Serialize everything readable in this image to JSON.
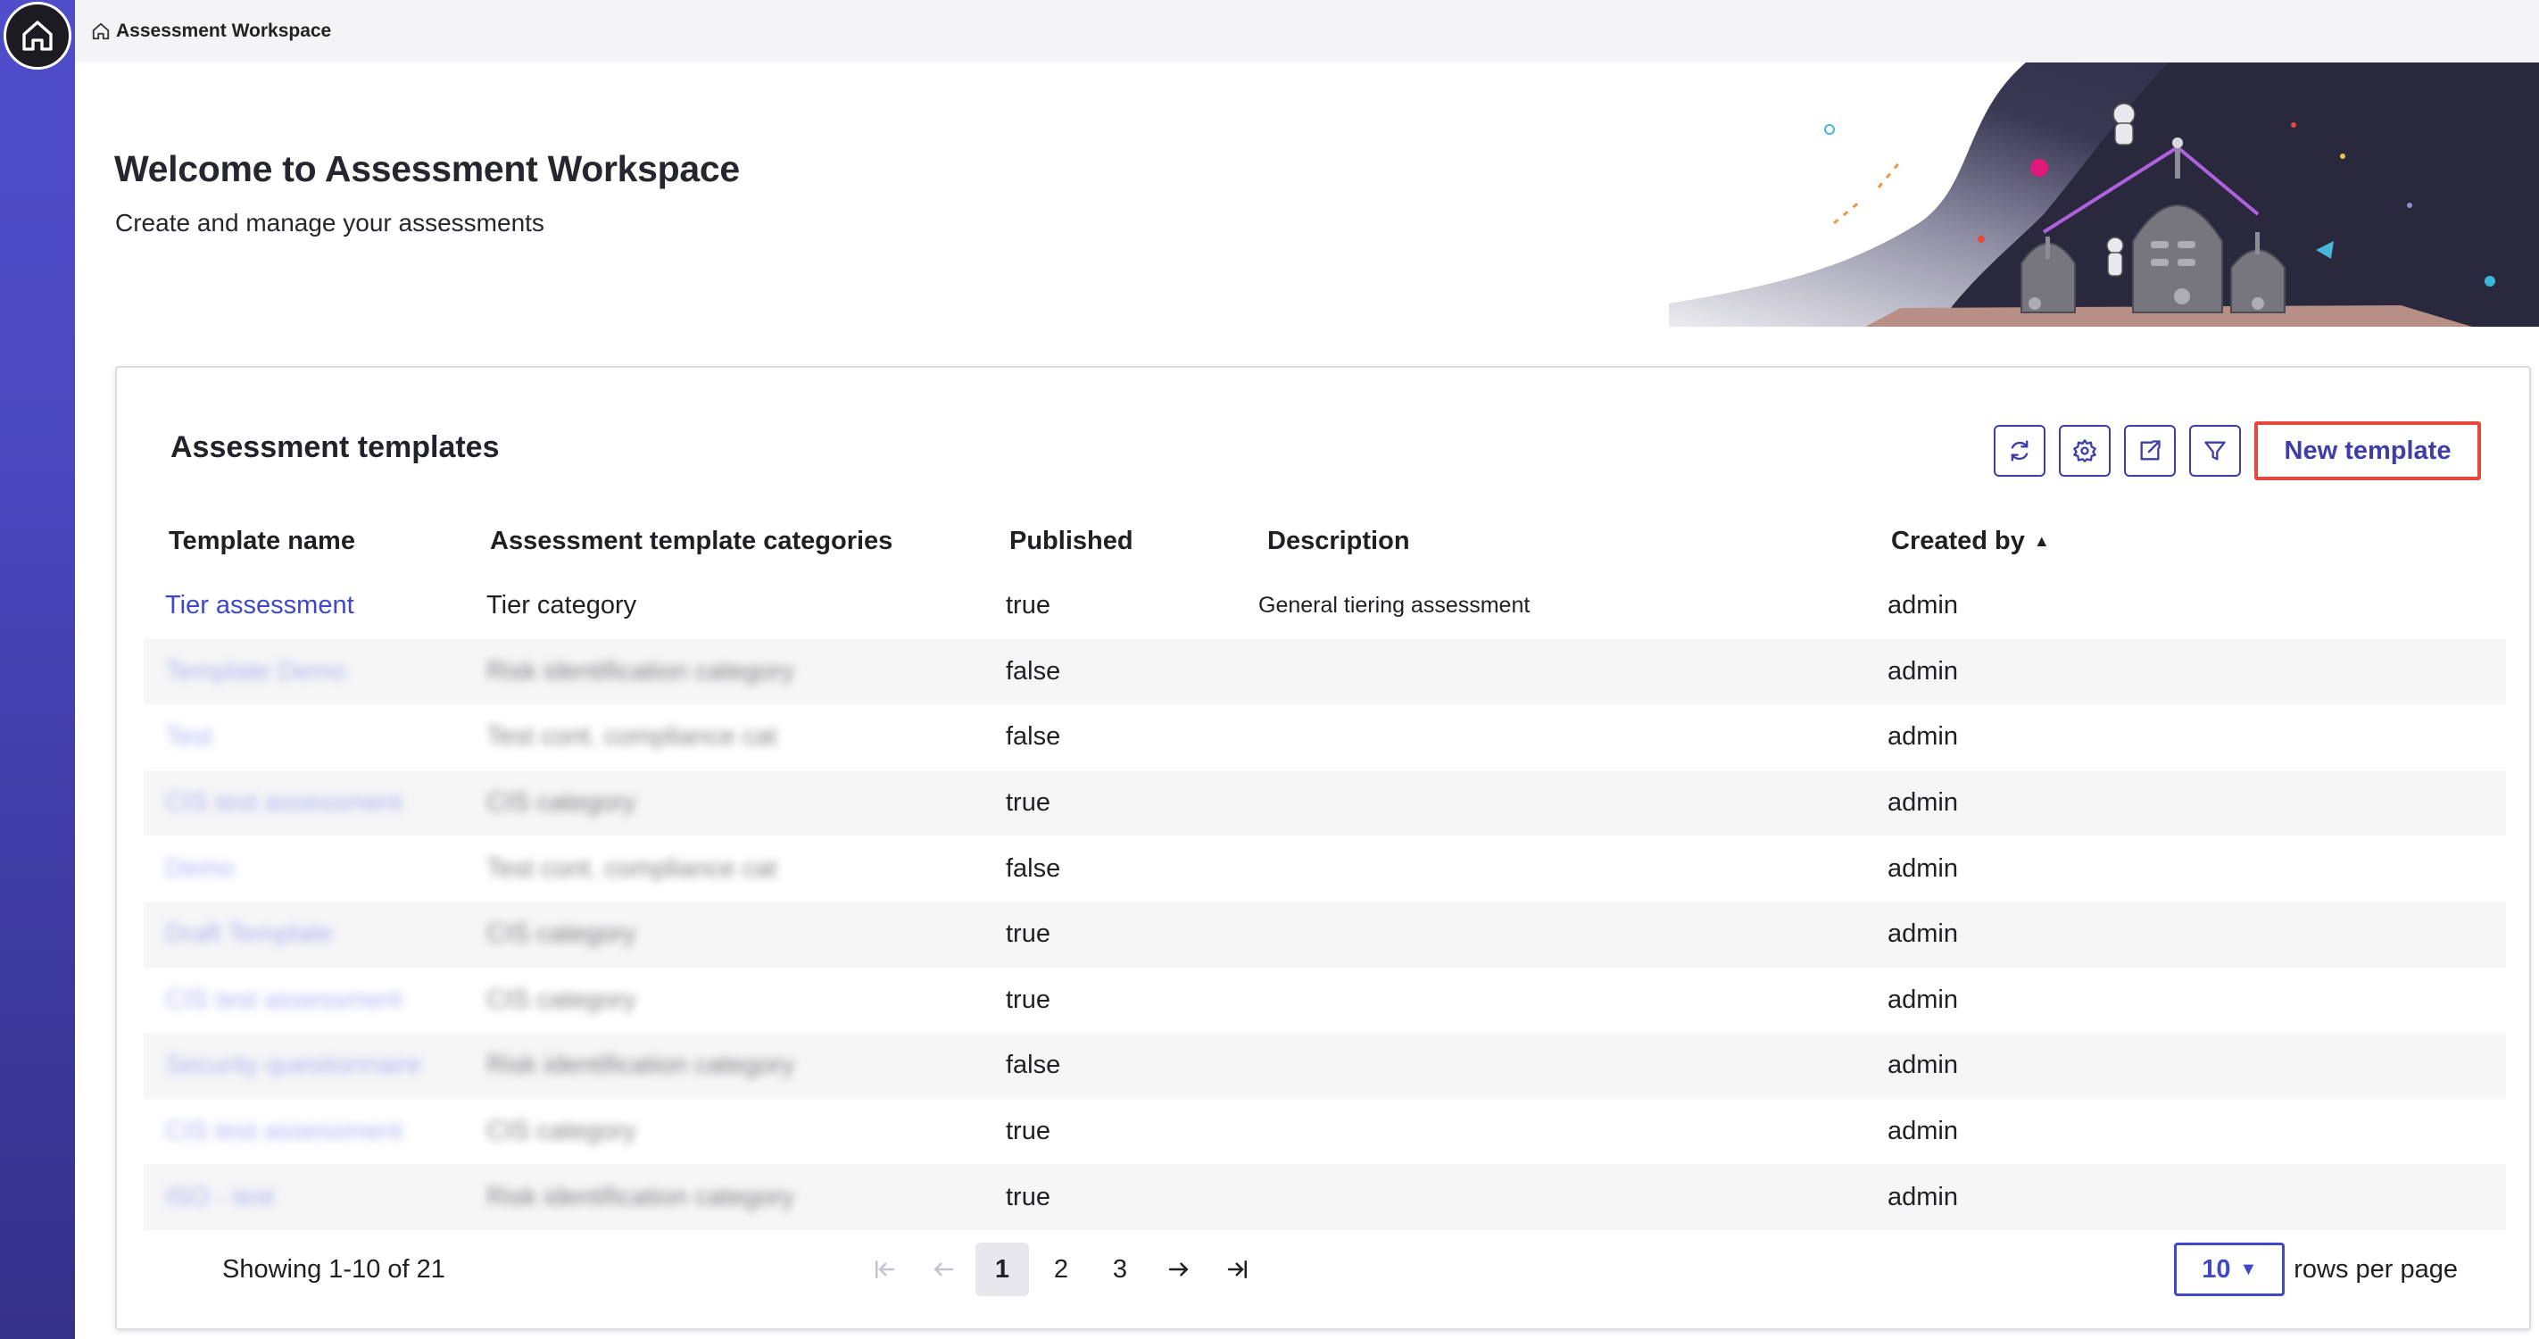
{
  "breadcrumb": {
    "label": "Assessment Workspace"
  },
  "hero": {
    "title": "Welcome to Assessment Workspace",
    "subtitle": "Create and manage your assessments"
  },
  "card": {
    "title": "Assessment templates",
    "new_button": "New template"
  },
  "table": {
    "columns": [
      "Template name",
      "Assessment template categories",
      "Published",
      "Description",
      "Created by"
    ],
    "sort_indicator": "▲",
    "rows": [
      {
        "name": "Tier assessment",
        "category": "Tier category",
        "published": "true",
        "description": "General tiering assessment",
        "created_by": "admin"
      },
      {
        "name": "Template Demo",
        "category": "Risk identification category",
        "published": "false",
        "description": "",
        "created_by": "admin"
      },
      {
        "name": "Test",
        "category": "Test cont. compliance cat",
        "published": "false",
        "description": "",
        "created_by": "admin"
      },
      {
        "name": "CIS test assessment",
        "category": "CIS category",
        "published": "true",
        "description": "",
        "created_by": "admin"
      },
      {
        "name": "Demo",
        "category": "Test cont. compliance cat",
        "published": "false",
        "description": "",
        "created_by": "admin"
      },
      {
        "name": "Draft Template",
        "category": "CIS category",
        "published": "true",
        "description": "",
        "created_by": "admin"
      },
      {
        "name": "CIS test assessment",
        "category": "CIS category",
        "published": "true",
        "description": "",
        "created_by": "admin"
      },
      {
        "name": "Security questionnaire",
        "category": "Risk identification category",
        "published": "false",
        "description": "",
        "created_by": "admin"
      },
      {
        "name": "CIS test assessment",
        "category": "CIS category",
        "published": "true",
        "description": "",
        "created_by": "admin"
      },
      {
        "name": "ISO - test",
        "category": "Risk identification category",
        "published": "true",
        "description": "",
        "created_by": "admin"
      }
    ]
  },
  "pagination": {
    "showing": "Showing 1-10 of 21",
    "pages": [
      "1",
      "2",
      "3"
    ],
    "current_page": "1",
    "rows_per_page_value": "10",
    "rows_per_page_label": "rows per page"
  },
  "icons": {
    "home": "home-icon",
    "refresh": "refresh-icon",
    "settings": "gear-icon",
    "export": "export-icon",
    "filter": "filter-icon"
  },
  "colors": {
    "rail": "#4f4dc9",
    "accent": "#3f48cc",
    "highlight_border": "#e8473b"
  }
}
